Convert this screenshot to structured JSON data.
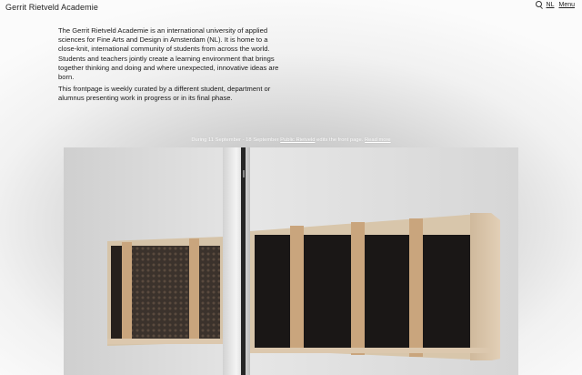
{
  "header": {
    "site_title": "Gerrit Rietveld Academie",
    "nav": {
      "search_icon": "search-icon",
      "language_label": "NL",
      "menu_label": "Menu"
    }
  },
  "intro": {
    "paragraph_1": "The Gerrit Rietveld Academie is an international university of applied sciences for Fine Arts and Design in Amsterdam (NL). It is home to a close-knit, international community of students from across the world. Students and teachers jointly create a learning environment that brings together thinking and doing and where unexpected, innovative ideas are born.",
    "paragraph_2": "This frontpage is weekly curated by a different student, department or alumnus presenting work in progress or in its final phase."
  },
  "announcement": {
    "prefix": "During 11 September - 18 September ",
    "link_text": "Public Rietveld",
    "middle": " edits the front page. ",
    "read_more": "Read more"
  }
}
